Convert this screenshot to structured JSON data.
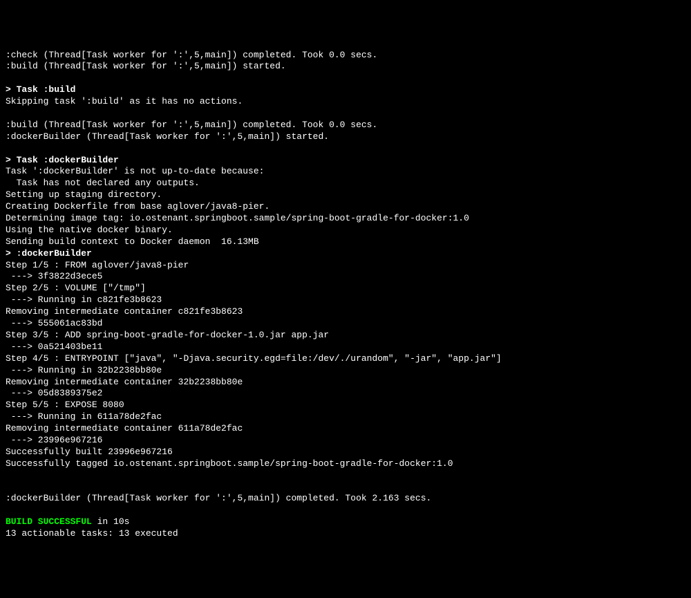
{
  "lines": [
    {
      "text": ":check (Thread[Task worker for ':',5,main]) completed. Took 0.0 secs.",
      "cls": ""
    },
    {
      "text": ":build (Thread[Task worker for ':',5,main]) started.",
      "cls": ""
    },
    {
      "text": "",
      "cls": ""
    },
    {
      "text": "> Task :build",
      "cls": "bold"
    },
    {
      "text": "Skipping task ':build' as it has no actions.",
      "cls": ""
    },
    {
      "text": "",
      "cls": ""
    },
    {
      "text": ":build (Thread[Task worker for ':',5,main]) completed. Took 0.0 secs.",
      "cls": ""
    },
    {
      "text": ":dockerBuilder (Thread[Task worker for ':',5,main]) started.",
      "cls": ""
    },
    {
      "text": "",
      "cls": ""
    },
    {
      "text": "> Task :dockerBuilder",
      "cls": "bold"
    },
    {
      "text": "Task ':dockerBuilder' is not up-to-date because:",
      "cls": ""
    },
    {
      "text": "  Task has not declared any outputs.",
      "cls": ""
    },
    {
      "text": "Setting up staging directory.",
      "cls": ""
    },
    {
      "text": "Creating Dockerfile from base aglover/java8-pier.",
      "cls": ""
    },
    {
      "text": "Determining image tag: io.ostenant.springboot.sample/spring-boot-gradle-for-docker:1.0",
      "cls": ""
    },
    {
      "text": "Using the native docker binary.",
      "cls": ""
    },
    {
      "text": "Sending build context to Docker daemon  16.13MB",
      "cls": ""
    },
    {
      "text": "> :dockerBuilder",
      "cls": "bold"
    },
    {
      "text": "Step 1/5 : FROM aglover/java8-pier",
      "cls": ""
    },
    {
      "text": " ---> 3f3822d3ece5",
      "cls": ""
    },
    {
      "text": "Step 2/5 : VOLUME [\"/tmp\"]",
      "cls": ""
    },
    {
      "text": " ---> Running in c821fe3b8623",
      "cls": ""
    },
    {
      "text": "Removing intermediate container c821fe3b8623",
      "cls": ""
    },
    {
      "text": " ---> 555061ac83bd",
      "cls": ""
    },
    {
      "text": "Step 3/5 : ADD spring-boot-gradle-for-docker-1.0.jar app.jar",
      "cls": ""
    },
    {
      "text": " ---> 0a521403be11",
      "cls": ""
    },
    {
      "text": "Step 4/5 : ENTRYPOINT [\"java\", \"-Djava.security.egd=file:/dev/./urandom\", \"-jar\", \"app.jar\"]",
      "cls": ""
    },
    {
      "text": " ---> Running in 32b2238bb80e",
      "cls": ""
    },
    {
      "text": "Removing intermediate container 32b2238bb80e",
      "cls": ""
    },
    {
      "text": " ---> 05d8389375e2",
      "cls": ""
    },
    {
      "text": "Step 5/5 : EXPOSE 8080",
      "cls": ""
    },
    {
      "text": " ---> Running in 611a78de2fac",
      "cls": ""
    },
    {
      "text": "Removing intermediate container 611a78de2fac",
      "cls": ""
    },
    {
      "text": " ---> 23996e967216",
      "cls": ""
    },
    {
      "text": "Successfully built 23996e967216",
      "cls": ""
    },
    {
      "text": "Successfully tagged io.ostenant.springboot.sample/spring-boot-gradle-for-docker:1.0",
      "cls": ""
    },
    {
      "text": "",
      "cls": ""
    },
    {
      "text": "",
      "cls": ""
    },
    {
      "text": ":dockerBuilder (Thread[Task worker for ':',5,main]) completed. Took 2.163 secs.",
      "cls": ""
    },
    {
      "text": "",
      "cls": ""
    }
  ],
  "build_status": {
    "prefix": "BUILD SUCCESSFUL",
    "suffix": " in 10s"
  },
  "summary": "13 actionable tasks: 13 executed"
}
